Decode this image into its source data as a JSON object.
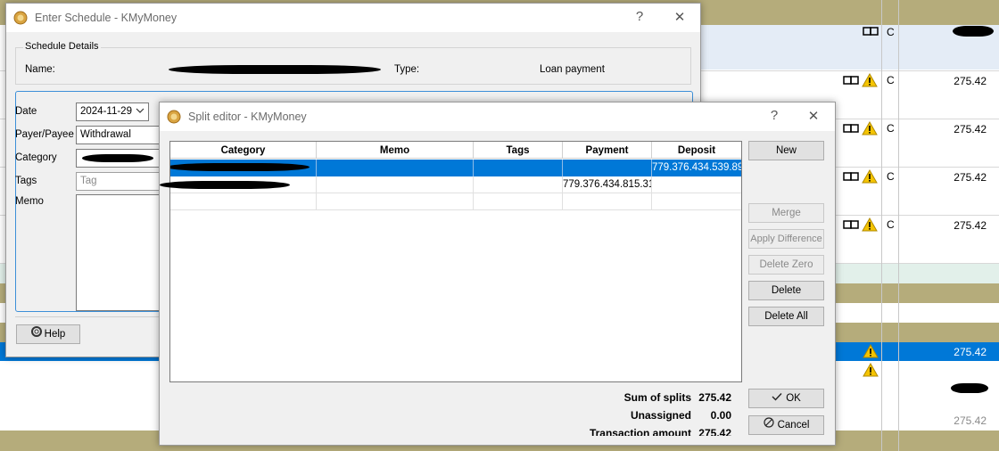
{
  "ledger": {
    "rows": [
      {
        "status": "C",
        "amount": "",
        "warn": false
      },
      {
        "status": "C",
        "amount": "275.42",
        "warn": true
      },
      {
        "status": "C",
        "amount": "275.42",
        "warn": true
      },
      {
        "status": "C",
        "amount": "275.42",
        "warn": true
      },
      {
        "status": "C",
        "amount": "275.42",
        "warn": true
      }
    ],
    "selected_amount": "275.42",
    "lower_amount": "275.42"
  },
  "schedule": {
    "title": "Enter Schedule - KMyMoney",
    "help_glyph": "?",
    "close_glyph": "✕",
    "details_group": "Schedule Details",
    "name_label": "Name:",
    "type_label": "Type:",
    "type_value": "Loan payment",
    "date_label": "Date",
    "date_value": "2024-11-29",
    "payee_label": "Payer/Payee",
    "payee_value": "Withdrawal",
    "category_label": "Category",
    "tags_label": "Tags",
    "tags_placeholder": "Tag",
    "memo_label": "Memo",
    "help_button": "Help"
  },
  "split": {
    "title": "Split editor - KMyMoney",
    "help_glyph": "?",
    "close_glyph": "✕",
    "columns": [
      "Category",
      "Memo",
      "Tags",
      "Payment",
      "Deposit"
    ],
    "rows": [
      {
        "category": "",
        "memo": "",
        "tags": "",
        "payment": "",
        "deposit": "779.376.434.539.89",
        "selected": true
      },
      {
        "category": "",
        "memo": "",
        "tags": "",
        "payment": "779.376.434.815.31",
        "deposit": "",
        "selected": false
      },
      {
        "category": "",
        "memo": "",
        "tags": "",
        "payment": "",
        "deposit": "",
        "selected": false
      }
    ],
    "buttons": {
      "new": "New",
      "merge": "Merge",
      "apply_difference": "Apply Difference",
      "delete_zero": "Delete Zero",
      "delete": "Delete",
      "delete_all": "Delete All",
      "ok": "OK",
      "cancel": "Cancel"
    },
    "summary": {
      "sum_label": "Sum of splits",
      "sum_value": "275.42",
      "unassigned_label": "Unassigned",
      "unassigned_value": "0.00",
      "transaction_label": "Transaction amount",
      "transaction_value": "275.42"
    }
  }
}
